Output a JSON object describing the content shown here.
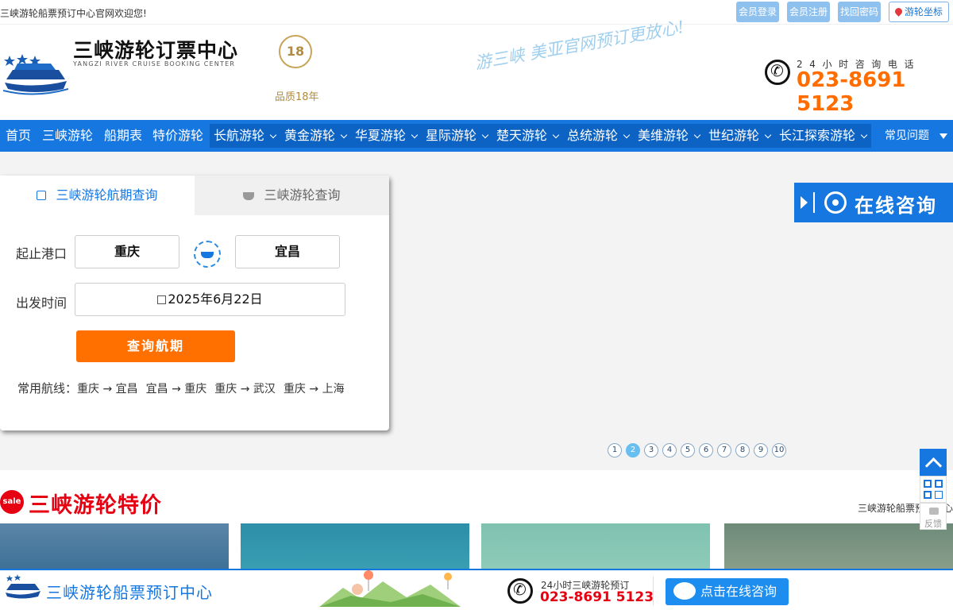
{
  "topbar": {
    "welcome": "三峡游轮船票预订中心官网欢迎您!",
    "login": "会员登录",
    "register": "会员注册",
    "recover": "找回密码",
    "coordinate": "游轮坐标"
  },
  "header": {
    "logo_title": "三峡游轮订票中心",
    "logo_subtitle": "YANGZI RIVER CRUISE BOOKING CENTER",
    "badge_number": "18",
    "badge_label": "品质18年",
    "slogan": "游三峡 美亚官网预订更放心!",
    "hotline_label": "24小时咨询电话",
    "hotline_number": "023-8691 5123"
  },
  "nav": {
    "items": [
      {
        "label": "首页"
      },
      {
        "label": "三峡游轮"
      },
      {
        "label": "船期表"
      },
      {
        "label": "特价游轮"
      },
      {
        "label": "长航游轮"
      },
      {
        "label": "黄金游轮"
      },
      {
        "label": "华夏游轮"
      },
      {
        "label": "星际游轮"
      },
      {
        "label": "楚天游轮"
      },
      {
        "label": "总统游轮"
      },
      {
        "label": "美维游轮"
      },
      {
        "label": "世纪游轮"
      },
      {
        "label": "长江探索游轮"
      }
    ],
    "faq": "常见问题"
  },
  "search": {
    "tab_schedule": "三峡游轮航期查询",
    "tab_cruise": "三峡游轮查询",
    "port_label": "起止港口",
    "from_port": "重庆",
    "to_port": "宜昌",
    "date_label": "出发时间",
    "date_value": "2025年6月22日",
    "button": "查询航期",
    "routes_label": "常用航线：",
    "routes": [
      "重庆 → 宜昌",
      "宜昌 → 重庆",
      "重庆 → 武汉",
      "重庆 → 上海"
    ]
  },
  "consult": {
    "label": "在线咨询"
  },
  "pager": {
    "pages": [
      "1",
      "2",
      "3",
      "4",
      "5",
      "6",
      "7",
      "8",
      "9",
      "10"
    ],
    "active": 2
  },
  "section": {
    "sale_badge": "sale",
    "title": "三峡游轮特价",
    "more": "三峡游轮船票预订中心"
  },
  "floats": {
    "feedback": "反馈"
  },
  "footer": {
    "logo": "三峡游轮船票预订中心",
    "phone_label": "24小时三峡游轮预订",
    "phone": "023-8691 5123",
    "chat_button": "点击在线咨询"
  },
  "colors": {
    "brand_blue": "#1677e0",
    "accent_orange": "#ff7000",
    "sale_red": "#e60012"
  }
}
